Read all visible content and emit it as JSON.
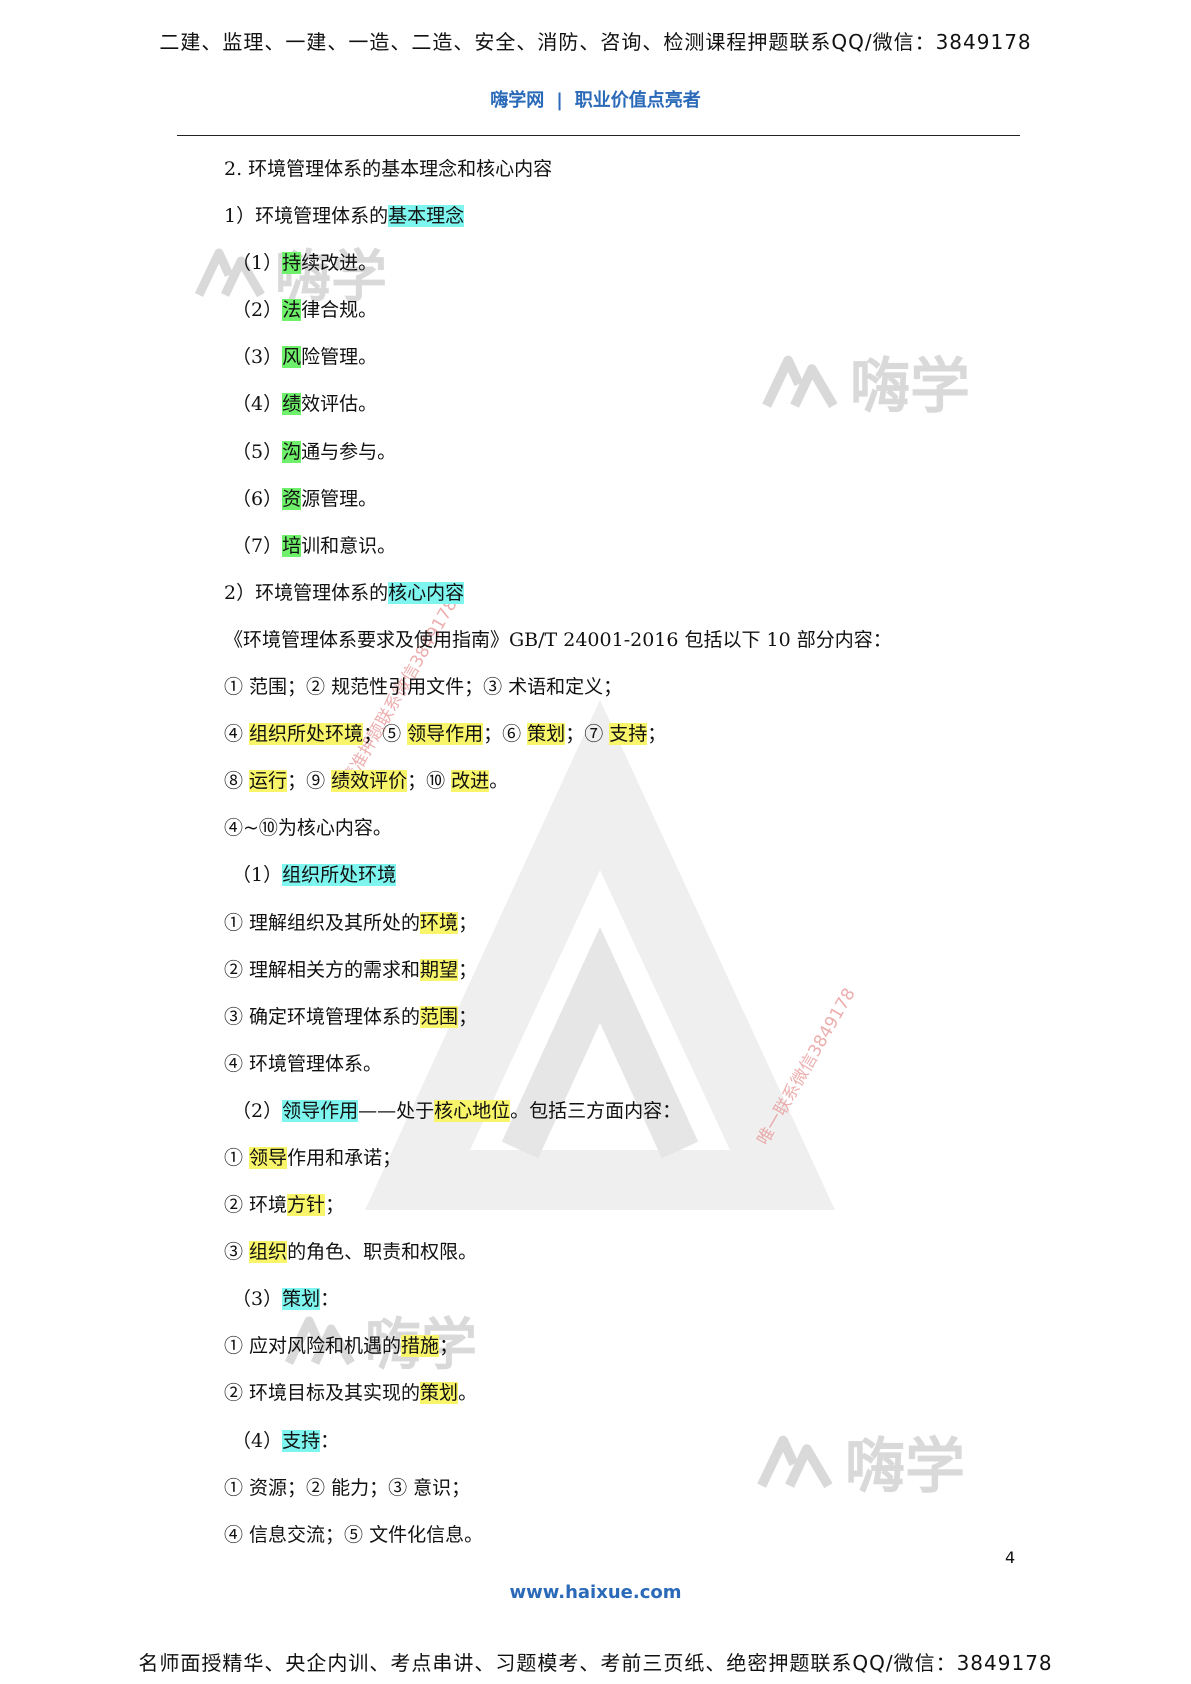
{
  "header": {
    "banner": "二建、监理、一建、一造、二造、安全、消防、咨询、检测课程押题联系QQ/微信：3849178",
    "brand_left": "嗨学网",
    "brand_sep": "|",
    "brand_right": "职业价值点亮者"
  },
  "watermarks": {
    "logo_text": "嗨学",
    "vertical_1": "精准押题联系微信3849178",
    "vertical_2": "唯一联系微信3849178"
  },
  "lines": [
    {
      "segs": [
        {
          "t": "2. 环境管理体系的基本理念和核心内容"
        }
      ]
    },
    {
      "segs": [
        {
          "t": "1）环境管理体系的"
        },
        {
          "t": "基本理念",
          "hl": "c"
        }
      ]
    },
    {
      "indent": true,
      "segs": [
        {
          "t": "（1）"
        },
        {
          "t": "持",
          "hl": "g"
        },
        {
          "t": "续改进。"
        }
      ]
    },
    {
      "indent": true,
      "segs": [
        {
          "t": "（2）"
        },
        {
          "t": "法",
          "hl": "g"
        },
        {
          "t": "律合规。"
        }
      ]
    },
    {
      "indent": true,
      "segs": [
        {
          "t": "（3）"
        },
        {
          "t": "风",
          "hl": "g"
        },
        {
          "t": "险管理。"
        }
      ]
    },
    {
      "indent": true,
      "segs": [
        {
          "t": "（4）"
        },
        {
          "t": "绩",
          "hl": "g"
        },
        {
          "t": "效评估。"
        }
      ]
    },
    {
      "indent": true,
      "segs": [
        {
          "t": "（5）"
        },
        {
          "t": "沟",
          "hl": "g"
        },
        {
          "t": "通与参与。"
        }
      ]
    },
    {
      "indent": true,
      "segs": [
        {
          "t": "（6）"
        },
        {
          "t": "资",
          "hl": "g"
        },
        {
          "t": "源管理。"
        }
      ]
    },
    {
      "indent": true,
      "segs": [
        {
          "t": "（7）"
        },
        {
          "t": "培",
          "hl": "g"
        },
        {
          "t": "训和意识。"
        }
      ]
    },
    {
      "segs": [
        {
          "t": "2）环境管理体系的"
        },
        {
          "t": "核心内容",
          "hl": "c"
        }
      ]
    },
    {
      "segs": [
        {
          "t": "《环境管理体系要求及使用指南》GB/T 24001-2016 包括以下 10 部分内容："
        }
      ]
    },
    {
      "segs": [
        {
          "t": "① 范围；② 规范性引用文件；③ 术语和定义；"
        }
      ]
    },
    {
      "segs": [
        {
          "t": "④ "
        },
        {
          "t": "组织所处环境",
          "hl": "y"
        },
        {
          "t": "；⑤ "
        },
        {
          "t": "领导作用",
          "hl": "y"
        },
        {
          "t": "；⑥ "
        },
        {
          "t": "策划",
          "hl": "y"
        },
        {
          "t": "；⑦ "
        },
        {
          "t": "支持",
          "hl": "y"
        },
        {
          "t": "；"
        }
      ]
    },
    {
      "segs": [
        {
          "t": "⑧ "
        },
        {
          "t": "运行",
          "hl": "y"
        },
        {
          "t": "；⑨ "
        },
        {
          "t": "绩效评价",
          "hl": "y"
        },
        {
          "t": "；⑩ "
        },
        {
          "t": "改进",
          "hl": "y"
        },
        {
          "t": "。"
        }
      ]
    },
    {
      "segs": [
        {
          "t": "④~⑩为核心内容。"
        }
      ]
    },
    {
      "indent": true,
      "segs": [
        {
          "t": "（1）"
        },
        {
          "t": "组织所处环境",
          "hl": "c"
        }
      ]
    },
    {
      "segs": [
        {
          "t": "① 理解组织及其所处的"
        },
        {
          "t": "环境",
          "hl": "y"
        },
        {
          "t": "；"
        }
      ]
    },
    {
      "segs": [
        {
          "t": "② 理解相关方的需求和"
        },
        {
          "t": "期望",
          "hl": "y"
        },
        {
          "t": "；"
        }
      ]
    },
    {
      "segs": [
        {
          "t": "③ 确定环境管理体系的"
        },
        {
          "t": "范围",
          "hl": "y"
        },
        {
          "t": "；"
        }
      ]
    },
    {
      "segs": [
        {
          "t": "④ 环境管理体系。"
        }
      ]
    },
    {
      "indent": true,
      "segs": [
        {
          "t": "（2）"
        },
        {
          "t": "领导作用",
          "hl": "c"
        },
        {
          "t": "——处于"
        },
        {
          "t": "核心地位",
          "hl": "y"
        },
        {
          "t": "。包括三方面内容："
        }
      ]
    },
    {
      "segs": [
        {
          "t": "① "
        },
        {
          "t": "领导",
          "hl": "y"
        },
        {
          "t": "作用和承诺；"
        }
      ]
    },
    {
      "segs": [
        {
          "t": "② 环境"
        },
        {
          "t": "方针",
          "hl": "y"
        },
        {
          "t": "；"
        }
      ]
    },
    {
      "segs": [
        {
          "t": "③ "
        },
        {
          "t": "组织",
          "hl": "y"
        },
        {
          "t": "的角色、职责和权限。"
        }
      ]
    },
    {
      "indent": true,
      "segs": [
        {
          "t": "（3）"
        },
        {
          "t": "策划",
          "hl": "c"
        },
        {
          "t": "："
        }
      ]
    },
    {
      "segs": [
        {
          "t": "① 应对风险和机遇的"
        },
        {
          "t": "措施",
          "hl": "y"
        },
        {
          "t": "；"
        }
      ]
    },
    {
      "segs": [
        {
          "t": "② 环境目标及其实现的"
        },
        {
          "t": "策划",
          "hl": "y"
        },
        {
          "t": "。"
        }
      ]
    },
    {
      "indent": true,
      "segs": [
        {
          "t": "（4）"
        },
        {
          "t": "支持",
          "hl": "c"
        },
        {
          "t": "："
        }
      ]
    },
    {
      "segs": [
        {
          "t": "① 资源；② 能力；③ 意识；"
        }
      ]
    },
    {
      "segs": [
        {
          "t": "④ 信息交流；⑤ 文件化信息。"
        }
      ]
    }
  ],
  "footer": {
    "page_number": "4",
    "url": "www.haixue.com",
    "banner": "名师面授精华、央企内训、考点串讲、习题模考、考前三页纸、绝密押题联系QQ/微信：3849178"
  }
}
